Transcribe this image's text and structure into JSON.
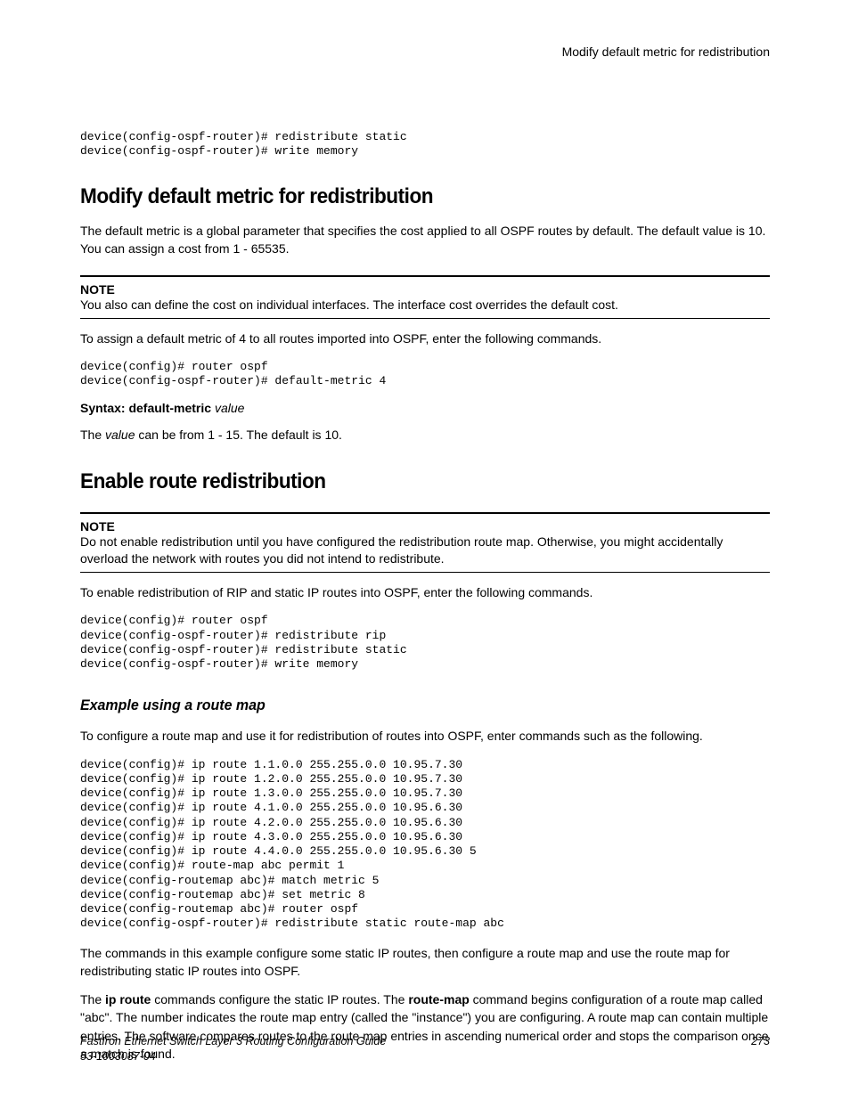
{
  "header": {
    "right": "Modify default metric for redistribution"
  },
  "code_top": "device(config-ospf-router)# redistribute static\ndevice(config-ospf-router)# write memory",
  "section1": {
    "title": "Modify default metric for redistribution",
    "intro": "The default metric is a global parameter that specifies the cost applied to all OSPF routes by default. The default value is 10. You can assign a cost from 1 - 65535.",
    "note_label": "NOTE",
    "note_text": "You also can define the cost on individual interfaces. The interface cost overrides the default cost.",
    "after_note": "To assign a default metric of 4 to all routes imported into OSPF, enter the following commands.",
    "code": "device(config)# router ospf\ndevice(config-ospf-router)# default-metric 4",
    "syntax_prefix": "Syntax: default-metric",
    "syntax_arg": "value",
    "value_line_1": "The ",
    "value_line_2": "value",
    "value_line_3": " can be from 1 - 15. The default is 10."
  },
  "section2": {
    "title": "Enable route redistribution",
    "note_label": "NOTE",
    "note_text": "Do not enable redistribution until you have configured the redistribution route map. Otherwise, you might accidentally overload the network with routes you did not intend to redistribute.",
    "after_note": "To enable redistribution of RIP and static IP routes into OSPF, enter the following commands.",
    "code": "device(config)# router ospf\ndevice(config-ospf-router)# redistribute rip\ndevice(config-ospf-router)# redistribute static\ndevice(config-ospf-router)# write memory"
  },
  "section3": {
    "title": "Example using a route map",
    "intro": "To configure a route map and use it for redistribution of routes into OSPF, enter commands such as the following.",
    "code": "device(config)# ip route 1.1.0.0 255.255.0.0 10.95.7.30\ndevice(config)# ip route 1.2.0.0 255.255.0.0 10.95.7.30\ndevice(config)# ip route 1.3.0.0 255.255.0.0 10.95.7.30\ndevice(config)# ip route 4.1.0.0 255.255.0.0 10.95.6.30\ndevice(config)# ip route 4.2.0.0 255.255.0.0 10.95.6.30\ndevice(config)# ip route 4.3.0.0 255.255.0.0 10.95.6.30\ndevice(config)# ip route 4.4.0.0 255.255.0.0 10.95.6.30 5\ndevice(config)# route-map abc permit 1\ndevice(config-routemap abc)# match metric 5\ndevice(config-routemap abc)# set metric 8\ndevice(config-routemap abc)# router ospf\ndevice(config-ospf-router)# redistribute static route-map abc",
    "para1": "The commands in this example configure some static IP routes, then configure a route map and use the route map for redistributing static IP routes into OSPF.",
    "para2_a": "The ",
    "para2_b": "ip route",
    "para2_c": " commands configure the static IP routes. The ",
    "para2_d": "route-map",
    "para2_e": " command begins configuration of a route map called \"abc\". The number indicates the route map entry (called the \"instance\") you are configuring. A route map can contain multiple entries. The software compares routes to the route map entries in ascending numerical order and stops the comparison once a match is found."
  },
  "footer": {
    "title": "FastIron Ethernet Switch Layer 3 Routing Configuration Guide",
    "doc": "53-1003087-04",
    "page": "273"
  }
}
